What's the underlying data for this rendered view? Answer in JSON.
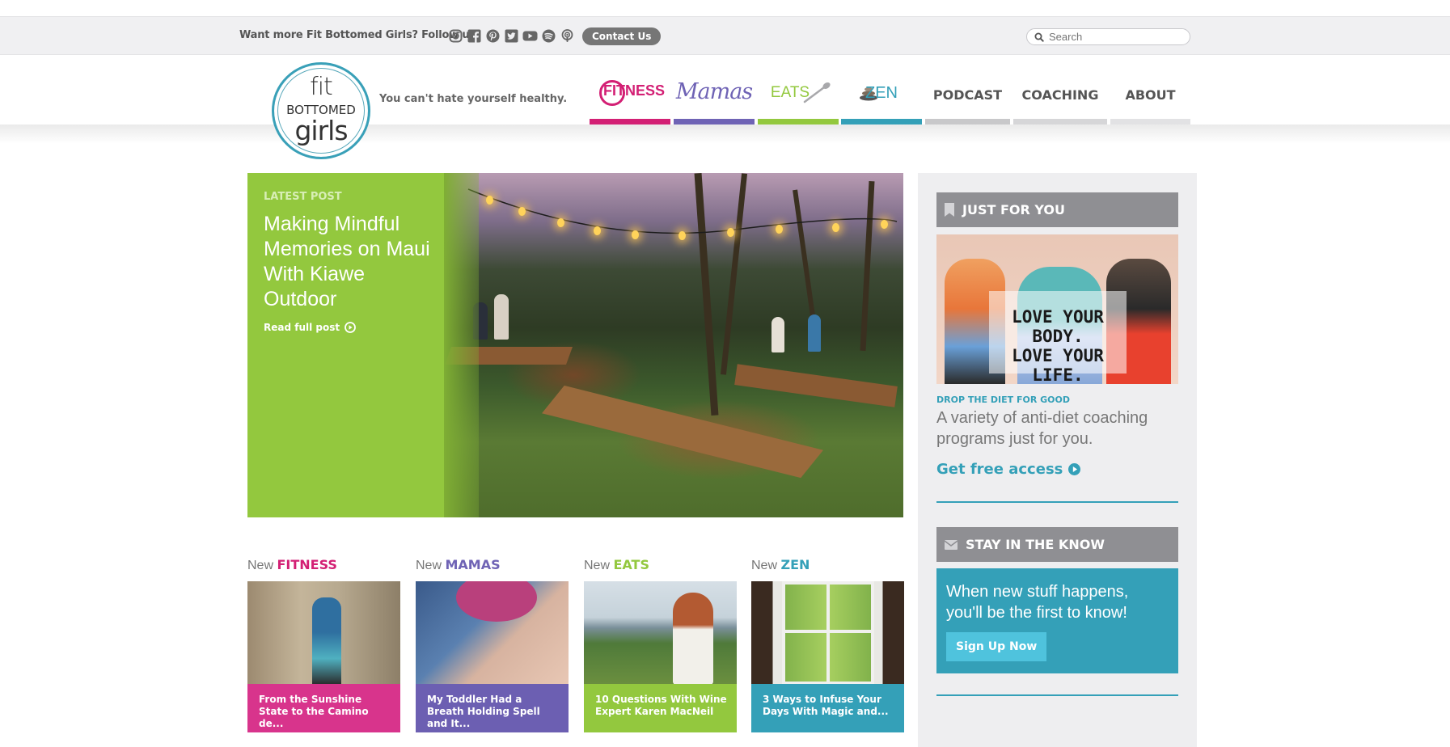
{
  "topbar": {
    "follow_text": "Want more Fit Bottomed Girls? Follow us:",
    "social_icons": [
      "instagram-icon",
      "facebook-icon",
      "pinterest-icon",
      "twitter-icon",
      "youtube-icon",
      "spotify-icon",
      "podcast-icon"
    ],
    "contact_label": "Contact Us",
    "search_placeholder": "Search"
  },
  "header": {
    "logo": {
      "line1": "fit",
      "line2": "BOTTOMED",
      "line3": "girls"
    },
    "tagline": "You can't hate yourself healthy.",
    "nav": [
      {
        "label": "FITNESS",
        "color": "#d31f74"
      },
      {
        "label": "Mamas",
        "color": "#6f63b5"
      },
      {
        "label": "EATS",
        "color": "#93c83e"
      },
      {
        "label": "ZEN",
        "color": "#34a0b8"
      },
      {
        "label": "PODCAST",
        "color": "#c8c8ca"
      },
      {
        "label": "COACHING",
        "color": "#d6d6d8"
      },
      {
        "label": "ABOUT",
        "color": "#e2e2e4"
      }
    ]
  },
  "hero": {
    "kicker": "LATEST POST",
    "title": "Making Mindful Memories on Maui With Kiawe Outdoor",
    "read_more": "Read full post"
  },
  "categories": [
    {
      "prefix": "New",
      "name": "FITNESS",
      "color": "#d31f74",
      "caption": "From the Sunshine State to the Camino de...",
      "caption_bg": "#d8348c"
    },
    {
      "prefix": "New",
      "name": "MAMAS",
      "color": "#6f63b5",
      "caption": "My Toddler Had a Breath Holding Spell and It...",
      "caption_bg": "#6c5fb2"
    },
    {
      "prefix": "New",
      "name": "EATS",
      "color": "#93c83e",
      "caption": "10 Questions With Wine Expert Karen MacNeil",
      "caption_bg": "#93c83e"
    },
    {
      "prefix": "New",
      "name": "ZEN",
      "color": "#34a0b8",
      "caption": "3 Ways to Infuse Your Days With Magic and...",
      "caption_bg": "#34a0b8"
    }
  ],
  "sidebar": {
    "just_for_you": {
      "heading": "JUST FOR YOU",
      "promo_line1": "LOVE YOUR BODY.",
      "promo_line2": "LOVE YOUR LIFE.",
      "kicker": "DROP THE DIET FOR GOOD",
      "description": "A variety of anti-diet coaching programs just for you.",
      "cta": "Get free access"
    },
    "stay_in_know": {
      "heading": "STAY IN THE KNOW",
      "text": "When new stuff happens, you'll be the first to know!",
      "button": "Sign Up Now"
    }
  }
}
